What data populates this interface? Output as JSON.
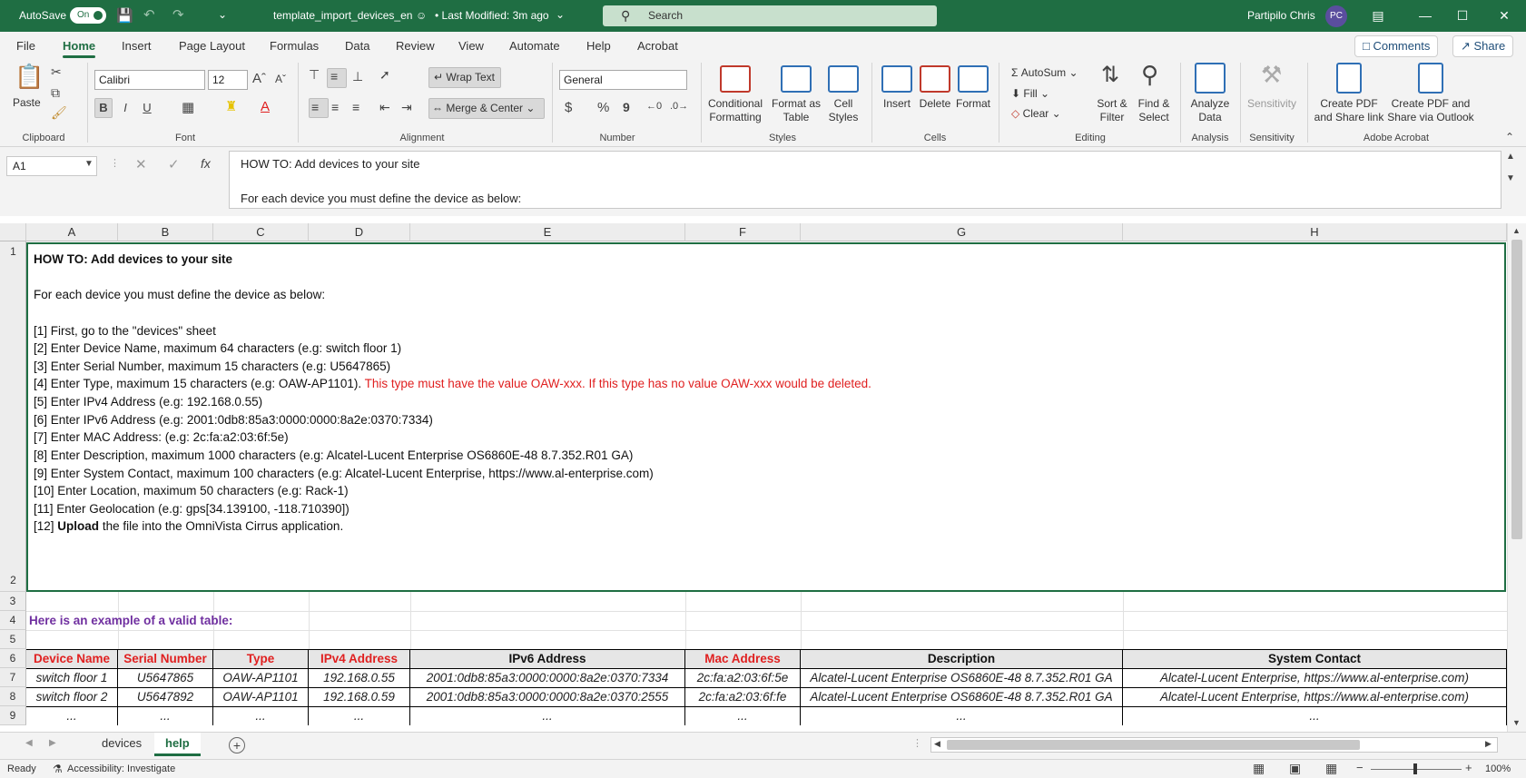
{
  "titlebar": {
    "autosave_label": "AutoSave",
    "autosave_state": "On",
    "filename": "template_import_devices_en",
    "modified": "• Last Modified: 3m ago",
    "search_placeholder": "Search",
    "user_name": "Partipilo Chris",
    "user_initials": "PC"
  },
  "menu": {
    "items": [
      "File",
      "Home",
      "Insert",
      "Page Layout",
      "Formulas",
      "Data",
      "Review",
      "View",
      "Automate",
      "Help",
      "Acrobat"
    ],
    "active": "Home",
    "comments_label": "Comments",
    "share_label": "Share"
  },
  "ribbon": {
    "clipboard": {
      "paste": "Paste",
      "label": "Clipboard"
    },
    "font": {
      "name": "Calibri",
      "size": "12",
      "label": "Font",
      "bold": "B",
      "italic": "I",
      "underline": "U"
    },
    "alignment": {
      "wrap": "Wrap Text",
      "merge": "Merge & Center",
      "label": "Alignment"
    },
    "number": {
      "format": "General",
      "label": "Number",
      "currency": "$",
      "percent": "%",
      "comma": "9"
    },
    "styles": {
      "conditional": "Conditional",
      "conditional2": "Formatting",
      "format_table": "Format as",
      "format_table2": "Table",
      "cell_styles": "Cell",
      "cell_styles2": "Styles",
      "label": "Styles"
    },
    "cells": {
      "insert": "Insert",
      "delete": "Delete",
      "format": "Format",
      "label": "Cells"
    },
    "editing": {
      "autosum": "AutoSum",
      "fill": "Fill",
      "clear": "Clear",
      "sort": "Sort &",
      "sort2": "Filter",
      "find": "Find &",
      "find2": "Select",
      "label": "Editing"
    },
    "analysis": {
      "analyze": "Analyze",
      "analyze2": "Data",
      "label": "Analysis"
    },
    "sensitivity": {
      "btn": "Sensitivity",
      "label": "Sensitivity"
    },
    "acrobat": {
      "pdf1": "Create PDF",
      "pdf1b": "and Share link",
      "pdf2": "Create PDF and",
      "pdf2b": "Share via Outlook",
      "label": "Adobe Acrobat"
    }
  },
  "formula_bar": {
    "name_box": "A1",
    "line1": "HOW TO: Add devices to your site",
    "line2": "For each device you must define the device as below:"
  },
  "columns": [
    "A",
    "B",
    "C",
    "D",
    "E",
    "F",
    "G",
    "H"
  ],
  "rows": [
    "1",
    "2",
    "3",
    "4",
    "5",
    "6",
    "7",
    "8",
    "9"
  ],
  "howto": {
    "title": "HOW TO: Add devices to your site",
    "intro": "For each device you must define the device as below:",
    "s1": "[1] First, go to the \"devices\" sheet",
    "s2": "[2] Enter Device Name, maximum 64 characters (e.g: switch floor 1)",
    "s3": "[3] Enter Serial Number, maximum 15 characters (e.g: U5647865)",
    "s4": "[4] Enter Type, maximum 15 characters (e.g: OAW-AP1101).",
    "s4_warning": "This type must have the value OAW-xxx. If this type has no value OAW-xxx would be deleted.",
    "s5": "[5] Enter IPv4 Address (e.g: 192.168.0.55)",
    "s6": "[6] Enter IPv6 Address (e.g: 2001:0db8:85a3:0000:0000:8a2e:0370:7334)",
    "s7": "[7] Enter MAC Address: (e.g: 2c:fa:a2:03:6f:5e)",
    "s8": "[8] Enter Description, maximum 1000 characters (e.g: Alcatel-Lucent Enterprise OS6860E-48 8.7.352.R01 GA)",
    "s9": "[9] Enter System Contact, maximum 100 characters (e.g: Alcatel-Lucent Enterprise, https://www.al-enterprise.com)",
    "s10": "[10] Enter Location, maximum 50 characters (e.g: Rack-1)",
    "s11": "[11] Enter Geolocation (e.g: gps[34.139100, -118.710390])",
    "s12_prefix": "[12]",
    "s12_bold": "Upload",
    "s12_rest": "the file into the OmniVista Cirrus application."
  },
  "example_label": "Here is an example of a valid table:",
  "table": {
    "headers": [
      "Device Name",
      "Serial Number",
      "Type",
      "IPv4 Address",
      "IPv6 Address",
      "Mac Address",
      "Description",
      "System Contact"
    ],
    "rows": [
      [
        "switch floor 1",
        "U5647865",
        "OAW-AP1101",
        "192.168.0.55",
        "2001:0db8:85a3:0000:0000:8a2e:0370:7334",
        "2c:fa:a2:03:6f:5e",
        "Alcatel-Lucent Enterprise OS6860E-48 8.7.352.R01 GA",
        "Alcatel-Lucent Enterprise, https://www.al-enterprise.com)"
      ],
      [
        "switch floor 2",
        "U5647892",
        "OAW-AP1101",
        "192.168.0.59",
        "2001:0db8:85a3:0000:0000:8a2e:0370:2555",
        "2c:fa:a2:03:6f:fe",
        "Alcatel-Lucent Enterprise OS6860E-48 8.7.352.R01 GA",
        "Alcatel-Lucent Enterprise, https://www.al-enterprise.com)"
      ],
      [
        "...",
        "...",
        "...",
        "...",
        "...",
        "...",
        "...",
        "..."
      ]
    ]
  },
  "sheets": [
    "devices",
    "help"
  ],
  "active_sheet": "help",
  "status": {
    "ready": "Ready",
    "accessibility": "Accessibility: Investigate",
    "zoom": "100%"
  },
  "colors": {
    "accent": "#1f6e43",
    "red": "#e02020",
    "purple": "#7030a0"
  }
}
